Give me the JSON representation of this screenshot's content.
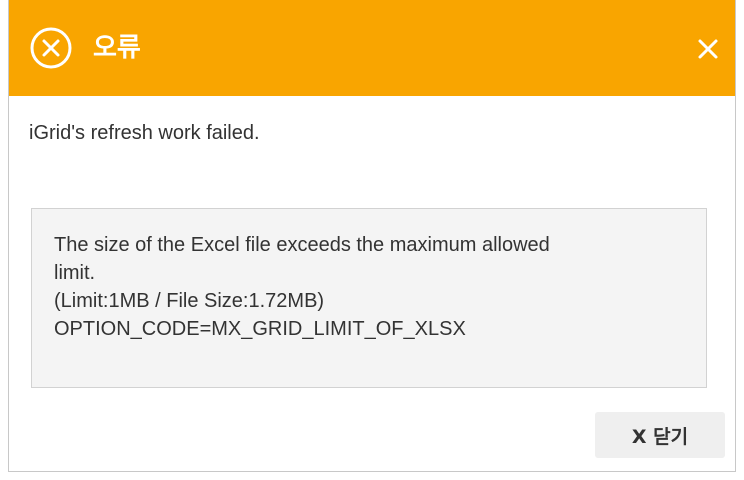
{
  "dialog": {
    "title": "오류",
    "header_color": "#f9a500",
    "icon": "error-circle-x-icon",
    "close_icon": "close-icon"
  },
  "message": "iGrid's refresh work failed.",
  "detail": {
    "lines": [
      "The size of the Excel file exceeds the maximum allowed",
      "limit.",
      "(Limit:1MB / File Size:1.72MB)",
      "OPTION_CODE=MX_GRID_LIMIT_OF_XLSX"
    ]
  },
  "buttons": {
    "close_label": "X 닫기"
  }
}
